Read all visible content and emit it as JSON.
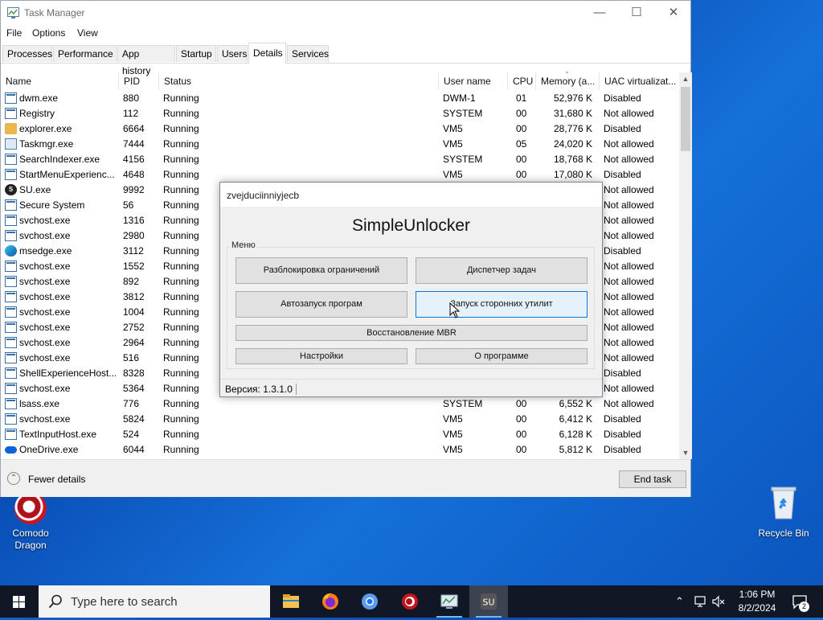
{
  "window": {
    "title": "Task Manager",
    "menu": [
      "File",
      "Options",
      "View"
    ],
    "tabs": [
      "Processes",
      "Performance",
      "App history",
      "Startup",
      "Users",
      "Details",
      "Services"
    ],
    "active_tab": "Details",
    "columns": [
      "Name",
      "PID",
      "Status",
      "User name",
      "CPU",
      "Memory (a...",
      "UAC virtualizat..."
    ],
    "rows": [
      {
        "icon": "window-icon",
        "name": "dwm.exe",
        "pid": "880",
        "status": "Running",
        "user": "DWM-1",
        "cpu": "01",
        "mem": "52,976 K",
        "uac": "Disabled"
      },
      {
        "icon": "window-icon",
        "name": "Registry",
        "pid": "112",
        "status": "Running",
        "user": "SYSTEM",
        "cpu": "00",
        "mem": "31,680 K",
        "uac": "Not allowed"
      },
      {
        "icon": "folder-icon",
        "name": "explorer.exe",
        "pid": "6664",
        "status": "Running",
        "user": "VM5",
        "cpu": "00",
        "mem": "28,776 K",
        "uac": "Disabled"
      },
      {
        "icon": "taskmgr-icon",
        "name": "Taskmgr.exe",
        "pid": "7444",
        "status": "Running",
        "user": "VM5",
        "cpu": "05",
        "mem": "24,020 K",
        "uac": "Not allowed"
      },
      {
        "icon": "window-icon",
        "name": "SearchIndexer.exe",
        "pid": "4156",
        "status": "Running",
        "user": "SYSTEM",
        "cpu": "00",
        "mem": "18,768 K",
        "uac": "Not allowed"
      },
      {
        "icon": "window-icon",
        "name": "StartMenuExperienc...",
        "pid": "4648",
        "status": "Running",
        "user": "VM5",
        "cpu": "00",
        "mem": "17,080 K",
        "uac": "Disabled"
      },
      {
        "icon": "su-icon",
        "name": "SU.exe",
        "pid": "9992",
        "status": "Running",
        "user": "",
        "cpu": "",
        "mem": "",
        "uac": "Not allowed"
      },
      {
        "icon": "window-icon",
        "name": "Secure System",
        "pid": "56",
        "status": "Running",
        "user": "",
        "cpu": "",
        "mem": "",
        "uac": "Not allowed"
      },
      {
        "icon": "window-icon",
        "name": "svchost.exe",
        "pid": "1316",
        "status": "Running",
        "user": "",
        "cpu": "",
        "mem": "",
        "uac": "Not allowed"
      },
      {
        "icon": "window-icon",
        "name": "svchost.exe",
        "pid": "2980",
        "status": "Running",
        "user": "",
        "cpu": "",
        "mem": "",
        "uac": "Not allowed"
      },
      {
        "icon": "edge-icon",
        "name": "msedge.exe",
        "pid": "3112",
        "status": "Running",
        "user": "",
        "cpu": "",
        "mem": "",
        "uac": "Disabled"
      },
      {
        "icon": "window-icon",
        "name": "svchost.exe",
        "pid": "1552",
        "status": "Running",
        "user": "",
        "cpu": "",
        "mem": "",
        "uac": "Not allowed"
      },
      {
        "icon": "window-icon",
        "name": "svchost.exe",
        "pid": "892",
        "status": "Running",
        "user": "",
        "cpu": "",
        "mem": "",
        "uac": "Not allowed"
      },
      {
        "icon": "window-icon",
        "name": "svchost.exe",
        "pid": "3812",
        "status": "Running",
        "user": "",
        "cpu": "",
        "mem": "",
        "uac": "Not allowed"
      },
      {
        "icon": "window-icon",
        "name": "svchost.exe",
        "pid": "1004",
        "status": "Running",
        "user": "",
        "cpu": "",
        "mem": "",
        "uac": "Not allowed"
      },
      {
        "icon": "window-icon",
        "name": "svchost.exe",
        "pid": "2752",
        "status": "Running",
        "user": "",
        "cpu": "",
        "mem": "",
        "uac": "Not allowed"
      },
      {
        "icon": "window-icon",
        "name": "svchost.exe",
        "pid": "2964",
        "status": "Running",
        "user": "",
        "cpu": "",
        "mem": "",
        "uac": "Not allowed"
      },
      {
        "icon": "window-icon",
        "name": "svchost.exe",
        "pid": "516",
        "status": "Running",
        "user": "",
        "cpu": "",
        "mem": "",
        "uac": "Not allowed"
      },
      {
        "icon": "window-icon",
        "name": "ShellExperienceHost....",
        "pid": "8328",
        "status": "Running",
        "user": "",
        "cpu": "",
        "mem": "",
        "uac": "Disabled"
      },
      {
        "icon": "window-icon",
        "name": "svchost.exe",
        "pid": "5364",
        "status": "Running",
        "user": "",
        "cpu": "",
        "mem": "",
        "uac": "Not allowed"
      },
      {
        "icon": "window-icon",
        "name": "lsass.exe",
        "pid": "776",
        "status": "Running",
        "user": "SYSTEM",
        "cpu": "00",
        "mem": "6,552 K",
        "uac": "Not allowed"
      },
      {
        "icon": "window-icon",
        "name": "svchost.exe",
        "pid": "5824",
        "status": "Running",
        "user": "VM5",
        "cpu": "00",
        "mem": "6,412 K",
        "uac": "Disabled"
      },
      {
        "icon": "window-icon",
        "name": "TextInputHost.exe",
        "pid": "524",
        "status": "Running",
        "user": "VM5",
        "cpu": "00",
        "mem": "6,128 K",
        "uac": "Disabled"
      },
      {
        "icon": "onedrive-icon",
        "name": "OneDrive.exe",
        "pid": "6044",
        "status": "Running",
        "user": "VM5",
        "cpu": "00",
        "mem": "5,812 K",
        "uac": "Disabled"
      }
    ],
    "fewer_details": "Fewer details",
    "end_task": "End task"
  },
  "dialog": {
    "title": "zvejduciinniyjecb",
    "heading": "SimpleUnlocker",
    "group_label": "Меню",
    "buttons": {
      "unlock": "Разблокировка ограничений",
      "task_manager": "Диспетчер задач",
      "autorun": "Автозапуск програм",
      "third_party": "Запуск сторонних утилит",
      "mbr": "Восстановление MBR",
      "settings": "Настройки",
      "about": "О программе"
    },
    "version": "Версия: 1.3.1.0"
  },
  "desktop": {
    "icons": [
      {
        "name": "Comodo\nDragon"
      },
      {
        "name": "Recycle Bin"
      }
    ]
  },
  "taskbar": {
    "search_placeholder": "Type here to search",
    "apps": [
      "file-explorer-icon",
      "firefox-icon",
      "chromium-icon",
      "comodo-dragon-icon",
      "task-manager-icon",
      "su-icon"
    ],
    "time": "1:06 PM",
    "date": "8/2/2024",
    "notification_count": "2"
  },
  "colors": {
    "desktop": "#0a55c0",
    "taskbar": "#101826",
    "accent": "#0078d7"
  }
}
